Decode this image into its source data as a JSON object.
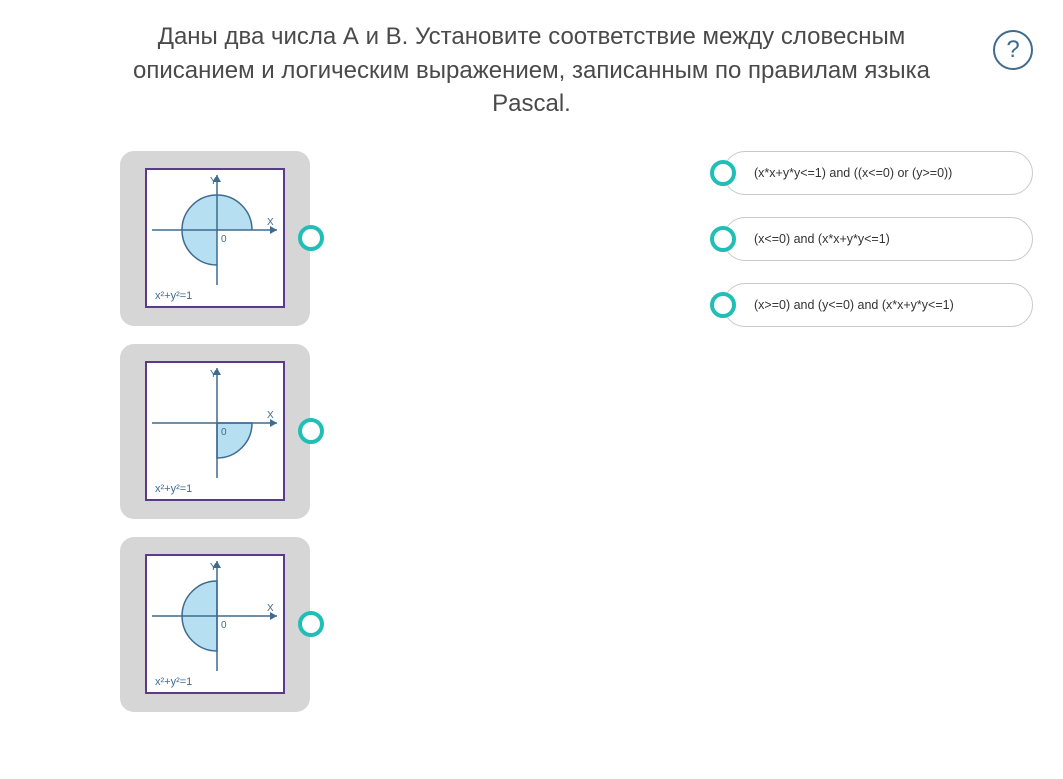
{
  "question": "Даны два числа А и В. Установите соответствие между словесным описанием и логическим выражением, записанным по правилам языка Pascal.",
  "help_label": "?",
  "circle_equation": "x²+y²=1",
  "axis_x": "X",
  "axis_y": "Y",
  "origin": "0",
  "graphs": [
    {
      "id": "graph-1",
      "shape": "three-quarter-circle-missing-q4"
    },
    {
      "id": "graph-2",
      "shape": "quarter-circle-q4"
    },
    {
      "id": "graph-3",
      "shape": "half-circle-left"
    }
  ],
  "answers": [
    {
      "text": "(x*x+y*y<=1) and ((x<=0) or (y>=0))"
    },
    {
      "text": "(x<=0) and (x*x+y*y<=1)"
    },
    {
      "text": "(x>=0) and (y<=0) and (x*x+y*y<=1)"
    }
  ]
}
